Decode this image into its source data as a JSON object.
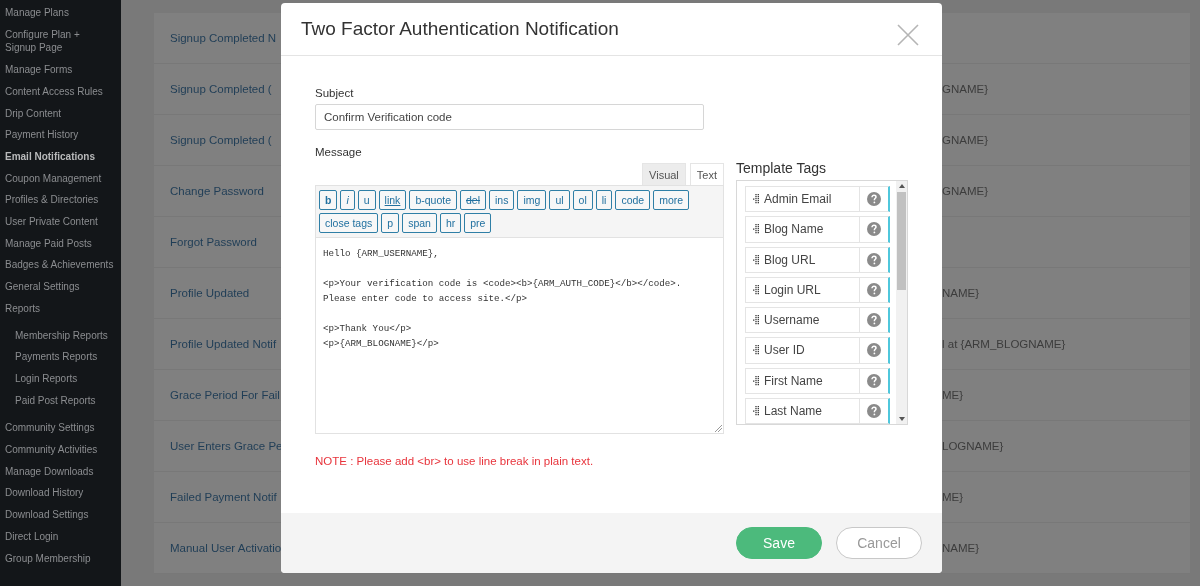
{
  "sidebar": {
    "items": [
      {
        "label": "Manage Plans",
        "selected": false
      },
      {
        "label": "Configure Plan + Signup Page",
        "selected": false
      },
      {
        "label": "Manage Forms",
        "selected": false
      },
      {
        "label": "Content Access Rules",
        "selected": false
      },
      {
        "label": "Drip Content",
        "selected": false
      },
      {
        "label": "Payment History",
        "selected": false
      },
      {
        "label": "Email Notifications",
        "selected": true
      },
      {
        "label": "Coupon Management",
        "selected": false
      },
      {
        "label": "Profiles & Directories",
        "selected": false
      },
      {
        "label": "User Private Content",
        "selected": false
      },
      {
        "label": "Manage Paid Posts",
        "selected": false
      },
      {
        "label": "Badges & Achievements",
        "selected": false
      },
      {
        "label": "General Settings",
        "selected": false
      },
      {
        "label": "Reports",
        "selected": false,
        "children": [
          {
            "label": "Membership Reports",
            "selected": false
          },
          {
            "label": "Payments Reports",
            "selected": false
          },
          {
            "label": "Login Reports",
            "selected": false
          },
          {
            "label": "Paid Post Reports",
            "selected": false
          }
        ]
      },
      {
        "label": "Community Settings",
        "selected": false
      },
      {
        "label": "Community Activities",
        "selected": false
      },
      {
        "label": "Manage Downloads",
        "selected": false
      },
      {
        "label": "Download History",
        "selected": false
      },
      {
        "label": "Download Settings",
        "selected": false
      },
      {
        "label": "Direct Login",
        "selected": false
      },
      {
        "label": "Group Membership",
        "selected": false
      }
    ]
  },
  "notification_rows": [
    {
      "title": "Signup Completed N"
    },
    {
      "title": "Signup Completed (",
      "column_2": "GNAME}"
    },
    {
      "title": "Signup Completed (",
      "column_2": "GNAME}"
    },
    {
      "title": "Change Password",
      "column_2": "GNAME}"
    },
    {
      "title": "Forgot Password"
    },
    {
      "title": "Profile Updated",
      "column_2": "NAME}"
    },
    {
      "title": "Profile Updated Notif",
      "column_2": "l at {ARM_BLOGNAME}"
    },
    {
      "title": "Grace Period For Fail",
      "column_2": "ME}"
    },
    {
      "title": "User Enters Grace Pe",
      "column_2": "LOGNAME}"
    },
    {
      "title": "Failed Payment Notif",
      "column_2": "ME}"
    },
    {
      "title": "Manual User Activatio",
      "column_2": "NAME}"
    }
  ],
  "modal": {
    "title": "Two Factor Authentication Notification",
    "subject": {
      "label": "Subject",
      "value": "Confirm Verification code"
    },
    "message": {
      "label": "Message",
      "tabs": [
        {
          "label": "Visual",
          "selected": false
        },
        {
          "label": "Text",
          "selected": true
        }
      ],
      "toolbar": [
        {
          "label": "b",
          "kind": "bold"
        },
        {
          "label": "i",
          "kind": "italic"
        },
        {
          "label": "u",
          "kind": "plain"
        },
        {
          "label": "link",
          "kind": "underline"
        },
        {
          "label": "b-quote",
          "kind": "plain"
        },
        {
          "label": "del",
          "kind": "strike"
        },
        {
          "label": "ins",
          "kind": "plain"
        },
        {
          "label": "img",
          "kind": "plain"
        },
        {
          "label": "ul",
          "kind": "plain"
        },
        {
          "label": "ol",
          "kind": "plain"
        },
        {
          "label": "li",
          "kind": "plain"
        },
        {
          "label": "code",
          "kind": "plain"
        },
        {
          "label": "more",
          "kind": "plain"
        },
        {
          "label": "close tags",
          "kind": "plain"
        },
        {
          "label": "p",
          "kind": "plain"
        },
        {
          "label": "span",
          "kind": "plain"
        },
        {
          "label": "hr",
          "kind": "plain"
        },
        {
          "label": "pre",
          "kind": "plain"
        }
      ],
      "paragraphs": [
        [
          "Hello {ARM_USERNAME},"
        ],
        [
          "<p>Your verification code is <code><b>{ARM_AUTH_CODE}</b></code>.",
          "Please enter code to access site.</p>"
        ],
        [
          "<p>Thank You</p>",
          "<p>{ARM_BLOGNAME}</p>"
        ]
      ]
    },
    "note": "NOTE : Please add <br> to use line break in plain text.",
    "template_tags": {
      "title": "Template Tags",
      "items": [
        "Admin Email",
        "Blog Name",
        "Blog URL",
        "Login URL",
        "Username",
        "User ID",
        "First Name",
        "Last Name"
      ]
    },
    "buttons": [
      {
        "label": "Save",
        "kind": "primary"
      },
      {
        "label": "Cancel",
        "kind": "secondary"
      }
    ]
  }
}
